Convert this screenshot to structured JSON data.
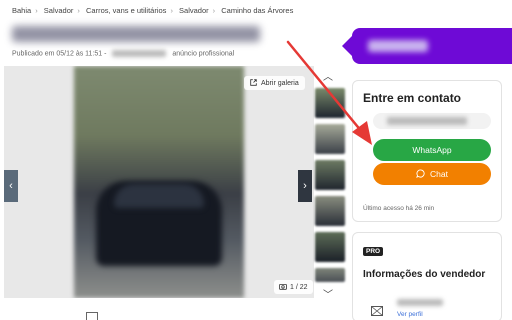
{
  "breadcrumb": [
    "Bahia",
    "Salvador",
    "Carros, vans e utilitários",
    "Salvador",
    "Caminho das Árvores"
  ],
  "listing": {
    "published_prefix": "Publicado em 05/12 às 11:51 -",
    "ad_type": "anúncio profissional"
  },
  "gallery": {
    "open_label": "Abrir galeria",
    "counter": "1 / 22"
  },
  "contact": {
    "title": "Entre em contato",
    "whatsapp_label": "WhatsApp",
    "chat_label": "Chat",
    "last_access": "Último acesso há 26 min"
  },
  "seller": {
    "badge": "PRO",
    "title": "Informações do vendedor",
    "profile_link": "Ver perfil"
  },
  "colors": {
    "brand_purple": "#6e0ad6",
    "whatsapp_green": "#28a745",
    "chat_orange": "#f28000",
    "annotation_red": "#e53935"
  },
  "icons": [
    "open-gallery-icon",
    "chevron-left-icon",
    "chevron-right-icon",
    "camera-icon",
    "chevron-up-icon",
    "chevron-down-icon",
    "whatsapp-icon",
    "chat-bubble-icon",
    "seller-icon"
  ]
}
